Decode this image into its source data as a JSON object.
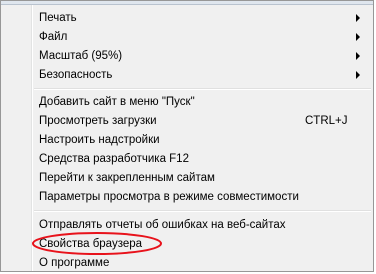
{
  "menu": {
    "items": [
      {
        "label": "Печать",
        "submenu": true
      },
      {
        "label": "Файл",
        "submenu": true
      },
      {
        "label": "Масштаб (95%)",
        "submenu": true
      },
      {
        "label": "Безопасность",
        "submenu": true
      },
      {
        "label": "Добавить сайт в меню \"Пуск\""
      },
      {
        "label": "Просмотреть загрузки",
        "shortcut": "CTRL+J"
      },
      {
        "label": "Настроить надстройки"
      },
      {
        "label": "Средства разработчика F12"
      },
      {
        "label": "Перейти к закрепленным сайтам"
      },
      {
        "label": "Параметры просмотра в режиме совместимости"
      },
      {
        "label": "Отправлять отчеты об ошибках на веб-сайтах"
      },
      {
        "label": "Свойства браузера",
        "annotated": true
      },
      {
        "label": "О программе"
      }
    ]
  },
  "colors": {
    "menu_background": "#f0f0f0",
    "annotation_ellipse": "#e8121b"
  }
}
